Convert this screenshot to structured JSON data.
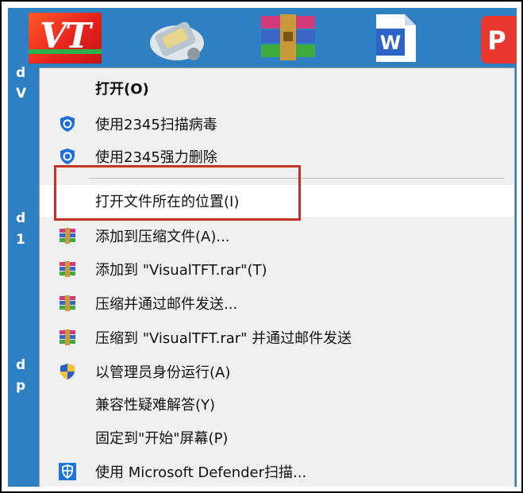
{
  "desktop": {
    "vt_icon_text": "VT",
    "left_labels": [
      "d",
      "V",
      "d",
      "1",
      "d",
      "p"
    ]
  },
  "context_menu": {
    "items": [
      {
        "label": "打开(O)",
        "icon": "none",
        "bold": true
      },
      {
        "label": "使用2345扫描病毒",
        "icon": "shield-2345-icon"
      },
      {
        "label": "使用2345强力删除",
        "icon": "shield-2345-icon"
      },
      {
        "label": "打开文件所在的位置(I)",
        "icon": "none",
        "highlighted": true
      },
      {
        "label": "添加到压缩文件(A)...",
        "icon": "winrar-icon"
      },
      {
        "label": "添加到 \"VisualTFT.rar\"(T)",
        "icon": "winrar-icon"
      },
      {
        "label": "压缩并通过邮件发送...",
        "icon": "winrar-icon"
      },
      {
        "label": "压缩到 \"VisualTFT.rar\" 并通过邮件发送",
        "icon": "winrar-icon"
      },
      {
        "label": "以管理员身份运行(A)",
        "icon": "uac-shield-icon"
      },
      {
        "label": "兼容性疑难解答(Y)",
        "icon": "none"
      },
      {
        "label": "固定到\"开始\"屏幕(P)",
        "icon": "none"
      },
      {
        "label": "使用 Microsoft Defender扫描...",
        "icon": "defender-icon"
      }
    ]
  },
  "colors": {
    "highlight_border": "#c33228",
    "menu_bg": "#f0f0f0",
    "shield_blue": "#1d6fd8"
  }
}
